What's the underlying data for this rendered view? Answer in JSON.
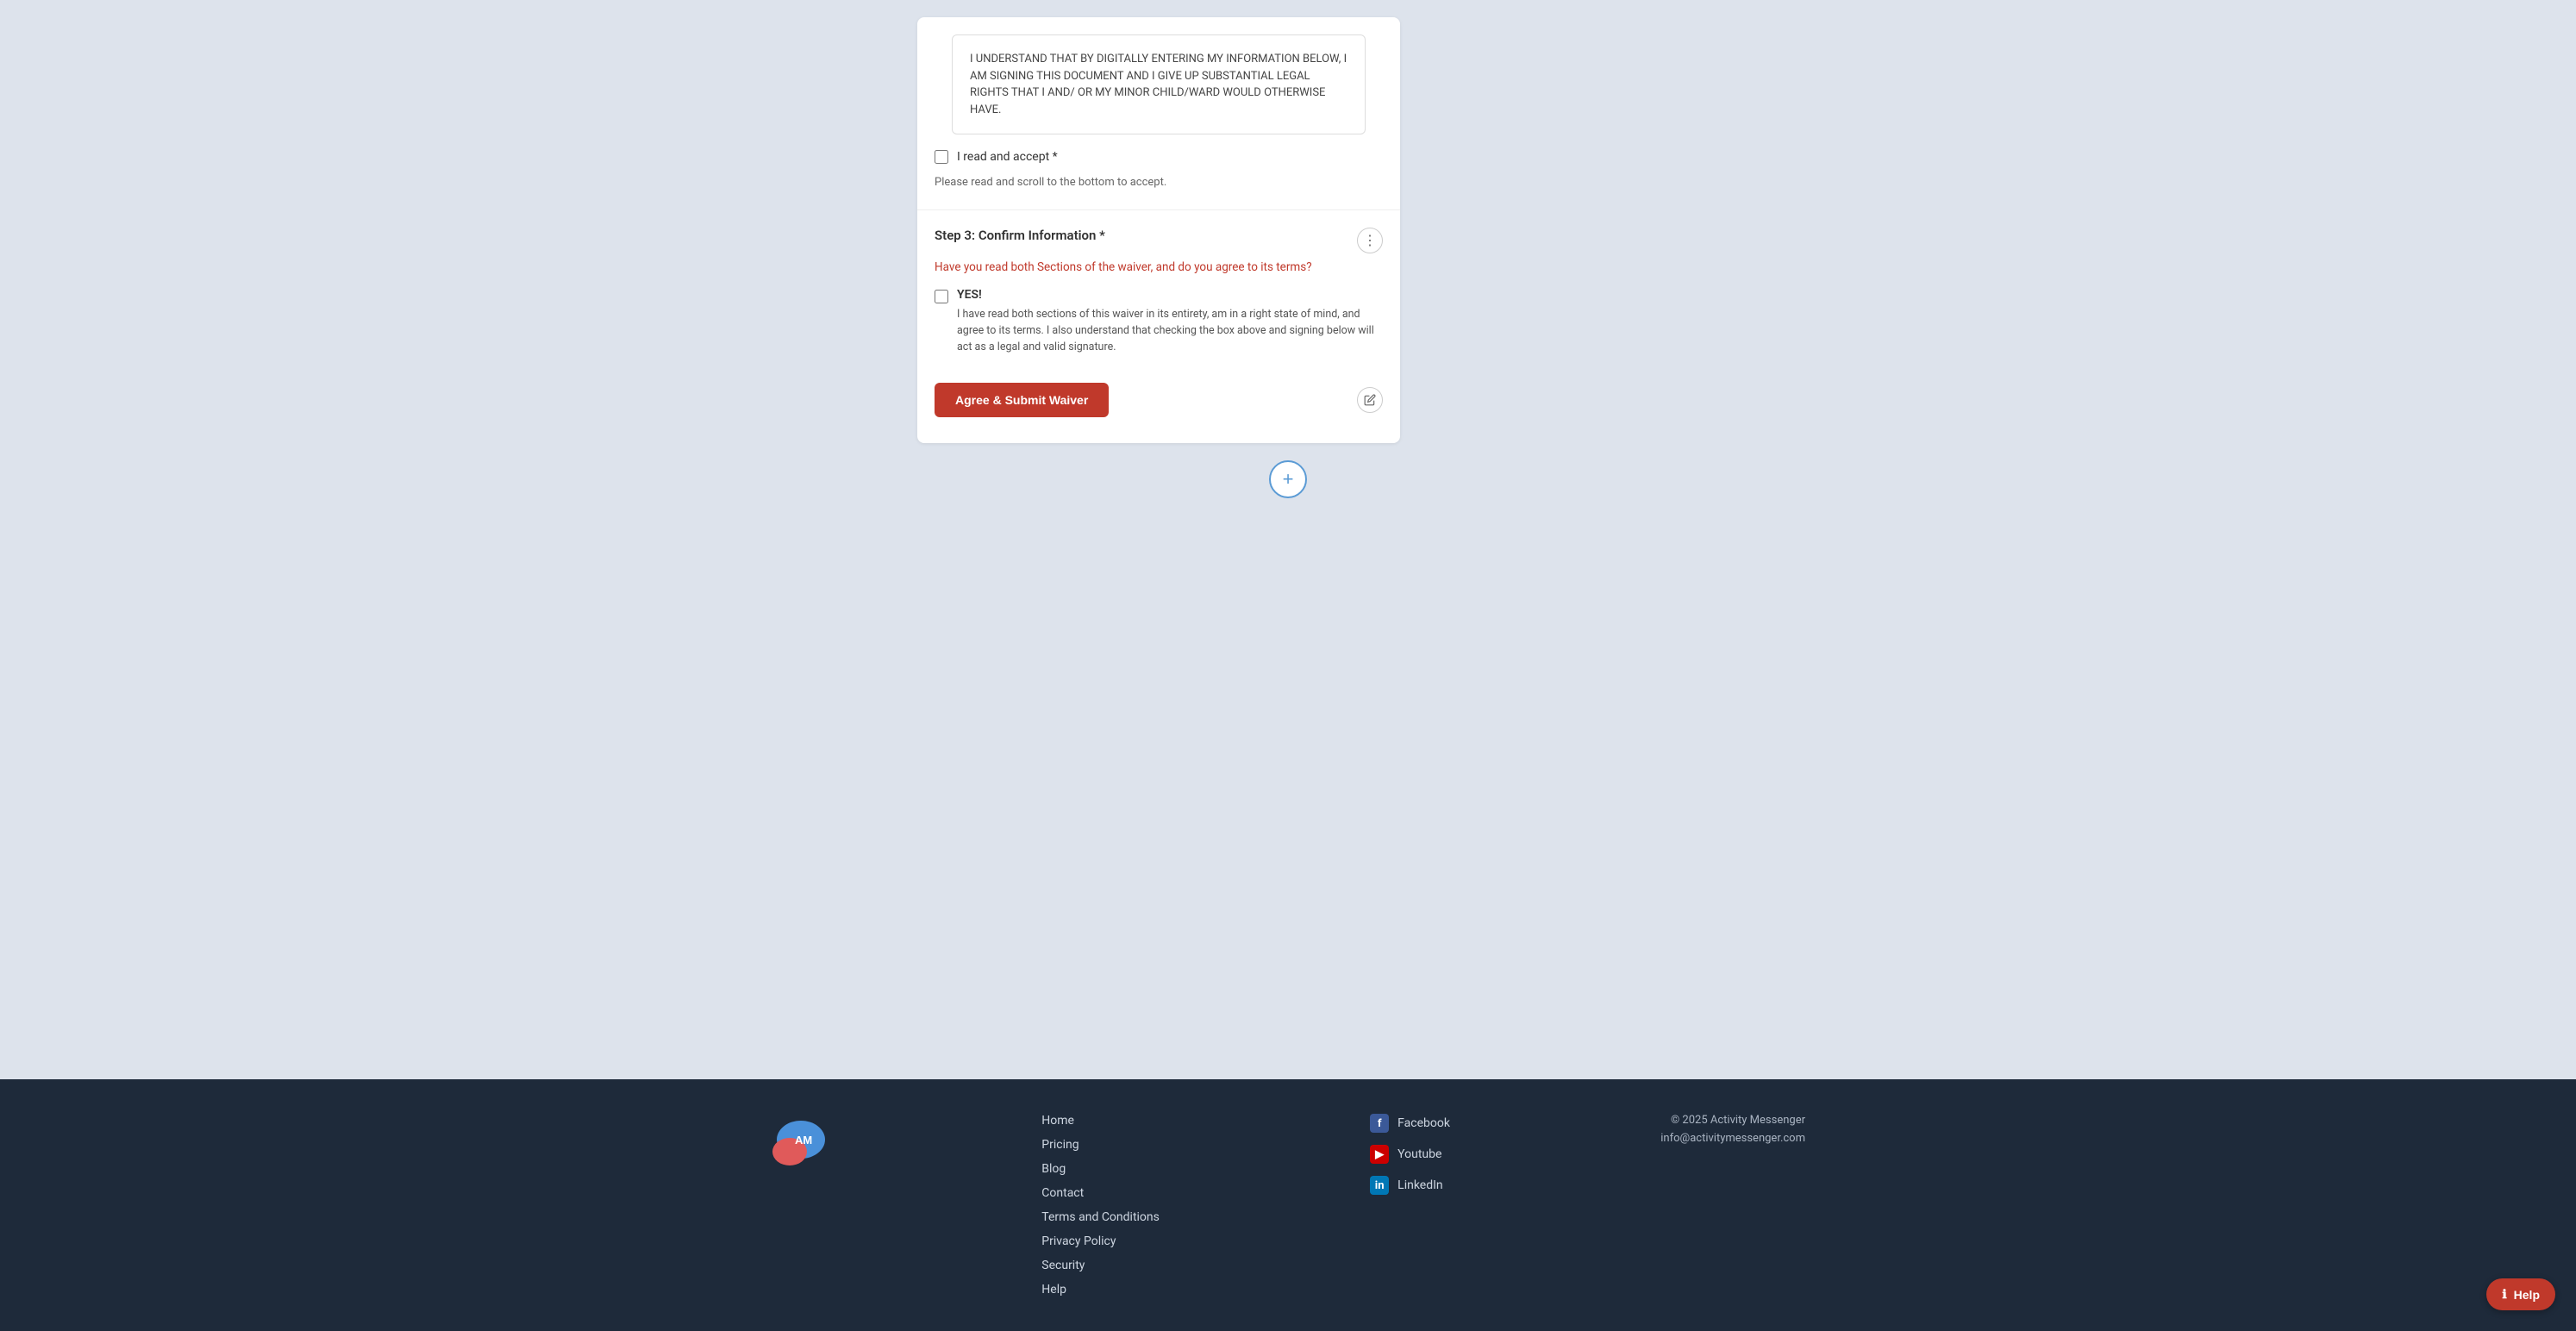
{
  "disclaimer": {
    "text": "I UNDERSTAND THAT BY DIGITALLY ENTERING MY INFORMATION BELOW, I AM SIGNING THIS DOCUMENT AND I GIVE UP SUBSTANTIAL LEGAL RIGHTS THAT I AND/ OR MY MINOR CHILD/WARD WOULD OTHERWISE HAVE."
  },
  "read_accept": {
    "label": "I read and accept *"
  },
  "help_text": "Please read and scroll to the bottom to accept.",
  "step3": {
    "title": "Step 3: Confirm Information *",
    "question": "Have you read both Sections of the waiver, and do you agree to its terms?",
    "yes_label": "YES!",
    "yes_description": "I have read both sections of this waiver in its entirety, am in a right state of mind, and agree to its terms. I also understand that checking the box above and signing below will act as a legal and valid signature."
  },
  "submit_button": "Agree & Submit Waiver",
  "add_section_label": "+",
  "footer": {
    "nav": [
      {
        "label": "Home",
        "href": "#"
      },
      {
        "label": "Pricing",
        "href": "#"
      },
      {
        "label": "Blog",
        "href": "#"
      },
      {
        "label": "Contact",
        "href": "#"
      },
      {
        "label": "Terms and Conditions",
        "href": "#"
      },
      {
        "label": "Privacy Policy",
        "href": "#"
      },
      {
        "label": "Security",
        "href": "#"
      },
      {
        "label": "Help",
        "href": "#"
      }
    ],
    "social": [
      {
        "name": "Facebook",
        "type": "fb",
        "icon": "f"
      },
      {
        "name": "Youtube",
        "type": "yt",
        "icon": "▶"
      },
      {
        "name": "LinkedIn",
        "type": "li",
        "icon": "in"
      }
    ],
    "copyright": "© 2025 Activity Messenger",
    "email": "info@activitymessenger.com"
  },
  "help_fab": "Help"
}
